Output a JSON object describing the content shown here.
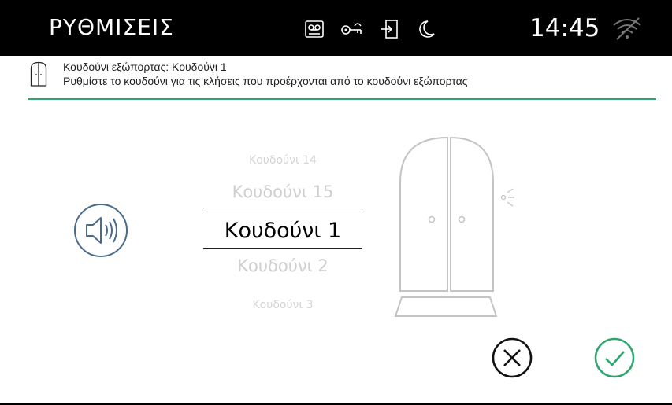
{
  "header": {
    "title": "ΡΥΘΜΙΣΕΙΣ",
    "time": "14:45",
    "status_icons": [
      "voicemail-icon",
      "key-icon",
      "door-exit-icon",
      "night-mode-icon"
    ],
    "wifi": "wifi-disabled-icon"
  },
  "info": {
    "line1": "Κουδούνι εξώπορτας: Κουδούνι 1",
    "line2": "Ρυθμίστε το κουδούνι για τις κλήσεις που προέρχονται από το κουδούνι εξώπορτας"
  },
  "picker": {
    "options": [
      "Κουδούνι 14",
      "Κουδούνι 15",
      "Κουδούνι 1",
      "Κουδούνι 2",
      "Κουδούνι 3"
    ],
    "selected": "Κουδούνι 1"
  },
  "actions": {
    "cancel": "cancel-icon",
    "confirm": "confirm-icon"
  },
  "colors": {
    "accent": "#2fa56f",
    "speaker": "#4a6a8a",
    "door": "#c4c4c4"
  }
}
